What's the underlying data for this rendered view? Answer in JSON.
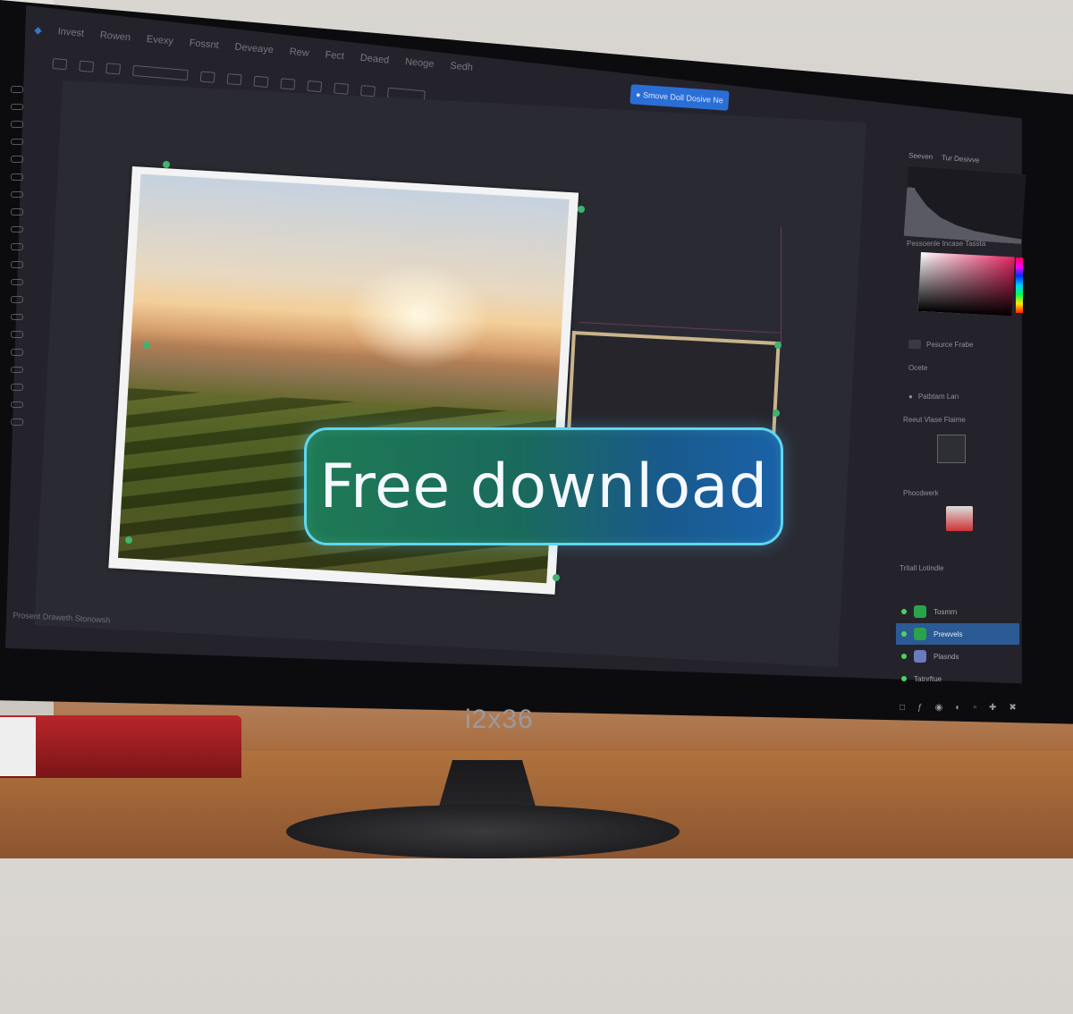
{
  "monitor": {
    "brand": "i2x36"
  },
  "menubar": {
    "items": [
      "Invest",
      "Rowen",
      "Evexy",
      "Fossnt",
      "Deveaye",
      "Rew",
      "Fect",
      "Deaed",
      "Neoge",
      "Sedh"
    ]
  },
  "canvas": {
    "status_text": "Prosent Draweth Stonowsh"
  },
  "share_button": {
    "label": "● Smove Doll Dosive Ne"
  },
  "panels": {
    "tabs": [
      "Seeven",
      "Tur Desivve"
    ],
    "swatches_label": "Pessoenle Incase Tassta",
    "properties_rows": [
      "Ocete",
      "Pesurce Frabe",
      "Patbtam Lan",
      "Reeut Vlase Flaime"
    ],
    "libraries_label": "Phocdwerk",
    "layers_label": "Tritall Lotindle",
    "layers": [
      {
        "name": "Tosmrn",
        "selected": false
      },
      {
        "name": "Prewvels",
        "selected": true
      },
      {
        "name": "Plasnds",
        "selected": false
      },
      {
        "name": "Tatnrftue",
        "selected": false
      }
    ]
  },
  "cta": {
    "label": "Free download"
  },
  "colors": {
    "accent": "#2b6fd6",
    "cta_start": "#1f7a55",
    "cta_end": "#1a62a8",
    "selection": "#3fb36f"
  }
}
